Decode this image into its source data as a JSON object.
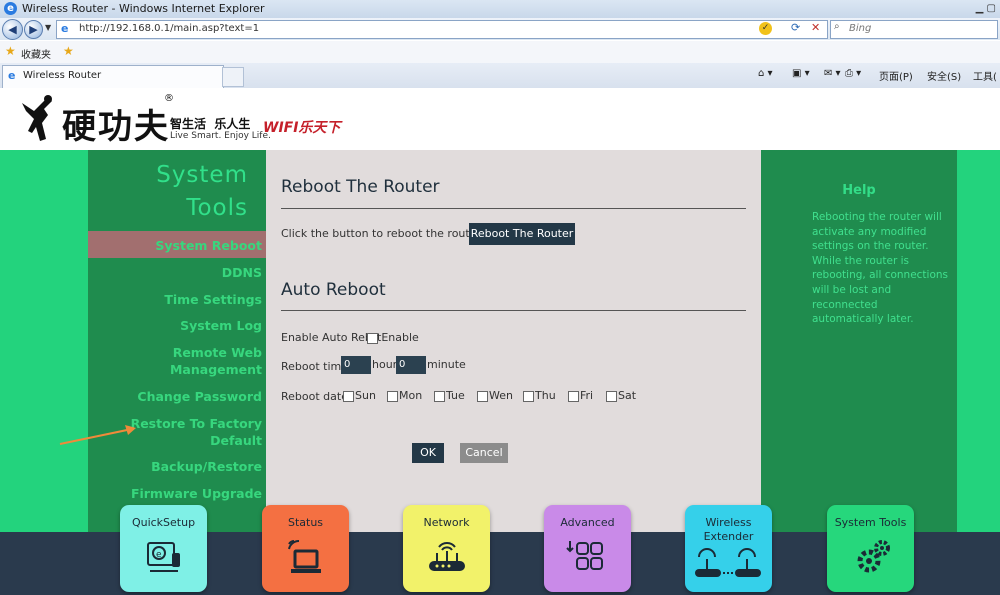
{
  "browser": {
    "window_title": "Wireless Router - Windows Internet Explorer",
    "url": "http://192.168.0.1/main.asp?text=1",
    "search_placeholder": "Bing",
    "favorites_label": "收藏夹",
    "tab_title": "Wireless Router",
    "commands": {
      "page": "页面(P)",
      "safety": "安全(S)",
      "tools": "工具("
    }
  },
  "brand": {
    "logo_text": "硬功夫",
    "registered": "®",
    "tagline_cn": "智生活  乐人生",
    "tagline_en": "Live Smart. Enjoy Life.",
    "wifi_slogan": "WIFI乐天下"
  },
  "sidebar": {
    "title_line1": "System",
    "title_line2": "Tools",
    "items": [
      {
        "label": "System Reboot"
      },
      {
        "label": "DDNS"
      },
      {
        "label": "Time Settings"
      },
      {
        "label": "System Log"
      },
      {
        "label": "Remote Web Management",
        "line1": "Remote Web",
        "line2": "Management"
      },
      {
        "label": "Change Password"
      },
      {
        "label": "Restore To Factory Default",
        "line1": "Restore To Factory",
        "line2": "Default"
      },
      {
        "label": "Backup/Restore"
      },
      {
        "label": "Firmware Upgrade"
      }
    ]
  },
  "reboot": {
    "title": "Reboot The Router",
    "prompt": "Click the button to reboot the router:",
    "button": "Reboot The Router"
  },
  "auto_reboot": {
    "title": "Auto Reboot",
    "enable_label": "Enable Auto Rebo",
    "enable_option": "tEnable",
    "time_label": "Reboot time",
    "hour_value": "0",
    "hour_label": "hour",
    "minute_value": "0",
    "minute_label": "minute",
    "date_label": "Reboot date",
    "days": [
      "Sun",
      "Mon",
      "Tue",
      "Wen",
      "Thu",
      "Fri",
      "Sat"
    ],
    "ok": "OK",
    "cancel": "Cancel"
  },
  "help": {
    "title": "Help",
    "text": "Rebooting the router will activate any modified settings on the router. While the router is rebooting, all connections will be lost and reconnected automatically later."
  },
  "tiles": [
    {
      "label": "QuickSetup",
      "color": "#7ff0e6",
      "icon": "quicksetup-icon"
    },
    {
      "label": "Status",
      "color": "#f47042",
      "icon": "laptop-wifi-icon"
    },
    {
      "label": "Network",
      "color": "#f2f26a",
      "icon": "router-icon"
    },
    {
      "label": "Advanced",
      "color": "#c98ae8",
      "icon": "grid-icon"
    },
    {
      "label": "Wireless Extender",
      "line1": "Wireless",
      "line2": "Extender",
      "color": "#35d0ea",
      "icon": "extender-icon"
    },
    {
      "label": "System Tools",
      "color": "#26d77c",
      "icon": "gears-icon"
    }
  ],
  "colors": {
    "accent_green": "#23d37d",
    "dark_green": "#1f8c4e",
    "content_bg": "#e1dcdc",
    "active_item": "#a26f6f",
    "button_dark": "#233847"
  }
}
